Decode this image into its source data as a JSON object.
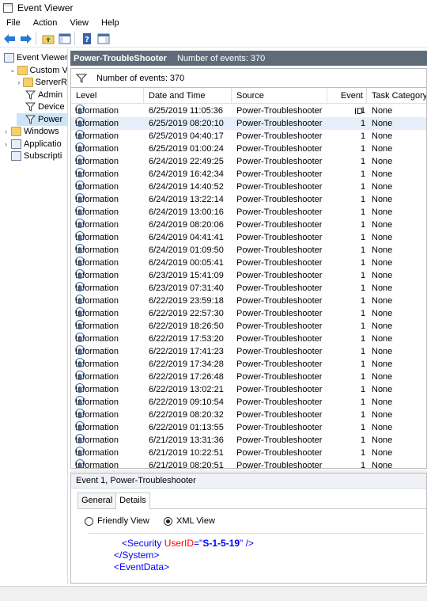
{
  "window": {
    "title": "Event Viewer"
  },
  "menu": [
    "File",
    "Action",
    "View",
    "Help"
  ],
  "toolbar": {
    "buttons": [
      "back-arrow",
      "forward-arrow",
      "folder-up",
      "show-hide-tree",
      "help-book",
      "show-hide-action-pane"
    ]
  },
  "tree": {
    "items": [
      {
        "label": "Event Viewer (",
        "indent": 0,
        "expander": "",
        "icon": "page"
      },
      {
        "label": "Custom V",
        "indent": 1,
        "expander": "⌄",
        "icon": "folder"
      },
      {
        "label": "ServerR",
        "indent": 2,
        "expander": "›",
        "icon": "folder"
      },
      {
        "label": "Admin",
        "indent": 2,
        "expander": "",
        "icon": "filter"
      },
      {
        "label": "Device",
        "indent": 2,
        "expander": "",
        "icon": "filter"
      },
      {
        "label": "Power",
        "indent": 2,
        "expander": "",
        "icon": "filter",
        "selected": true
      },
      {
        "label": "Windows",
        "indent": 0,
        "expander": "›",
        "icon": "folder"
      },
      {
        "label": "Applicatio",
        "indent": 0,
        "expander": "›",
        "icon": "page"
      },
      {
        "label": "Subscripti",
        "indent": 0,
        "expander": "",
        "icon": "page"
      }
    ]
  },
  "pane": {
    "title": "Power-TroubleShooter",
    "count_text": "Number of events: 370",
    "filter_text": "Number of events: 370"
  },
  "grid": {
    "columns": [
      "Level",
      "Date and Time",
      "Source",
      "Event ID",
      "Task Category"
    ],
    "rows": [
      [
        "Information",
        "6/25/2019 11:05:36",
        "Power-Troubleshooter",
        "1",
        "None"
      ],
      [
        "Information",
        "6/25/2019 08:20:10",
        "Power-Troubleshooter",
        "1",
        "None"
      ],
      [
        "Information",
        "6/25/2019 04:40:17",
        "Power-Troubleshooter",
        "1",
        "None"
      ],
      [
        "Information",
        "6/25/2019 01:00:24",
        "Power-Troubleshooter",
        "1",
        "None"
      ],
      [
        "Information",
        "6/24/2019 22:49:25",
        "Power-Troubleshooter",
        "1",
        "None"
      ],
      [
        "Information",
        "6/24/2019 16:42:34",
        "Power-Troubleshooter",
        "1",
        "None"
      ],
      [
        "Information",
        "6/24/2019 14:40:52",
        "Power-Troubleshooter",
        "1",
        "None"
      ],
      [
        "Information",
        "6/24/2019 13:22:14",
        "Power-Troubleshooter",
        "1",
        "None"
      ],
      [
        "Information",
        "6/24/2019 13:00:16",
        "Power-Troubleshooter",
        "1",
        "None"
      ],
      [
        "Information",
        "6/24/2019 08:20:06",
        "Power-Troubleshooter",
        "1",
        "None"
      ],
      [
        "Information",
        "6/24/2019 04:41:41",
        "Power-Troubleshooter",
        "1",
        "None"
      ],
      [
        "Information",
        "6/24/2019 01:09:50",
        "Power-Troubleshooter",
        "1",
        "None"
      ],
      [
        "Information",
        "6/24/2019 00:05:41",
        "Power-Troubleshooter",
        "1",
        "None"
      ],
      [
        "Information",
        "6/23/2019 15:41:09",
        "Power-Troubleshooter",
        "1",
        "None"
      ],
      [
        "Information",
        "6/23/2019 07:31:40",
        "Power-Troubleshooter",
        "1",
        "None"
      ],
      [
        "Information",
        "6/22/2019 23:59:18",
        "Power-Troubleshooter",
        "1",
        "None"
      ],
      [
        "Information",
        "6/22/2019 22:57:30",
        "Power-Troubleshooter",
        "1",
        "None"
      ],
      [
        "Information",
        "6/22/2019 18:26:50",
        "Power-Troubleshooter",
        "1",
        "None"
      ],
      [
        "Information",
        "6/22/2019 17:53:20",
        "Power-Troubleshooter",
        "1",
        "None"
      ],
      [
        "Information",
        "6/22/2019 17:41:23",
        "Power-Troubleshooter",
        "1",
        "None"
      ],
      [
        "Information",
        "6/22/2019 17:34:28",
        "Power-Troubleshooter",
        "1",
        "None"
      ],
      [
        "Information",
        "6/22/2019 17:26:48",
        "Power-Troubleshooter",
        "1",
        "None"
      ],
      [
        "Information",
        "6/22/2019 13:02:21",
        "Power-Troubleshooter",
        "1",
        "None"
      ],
      [
        "Information",
        "6/22/2019 09:10:54",
        "Power-Troubleshooter",
        "1",
        "None"
      ],
      [
        "Information",
        "6/22/2019 08:20:32",
        "Power-Troubleshooter",
        "1",
        "None"
      ],
      [
        "Information",
        "6/22/2019 01:13:55",
        "Power-Troubleshooter",
        "1",
        "None"
      ],
      [
        "Information",
        "6/21/2019 13:31:36",
        "Power-Troubleshooter",
        "1",
        "None"
      ],
      [
        "Information",
        "6/21/2019 10:22:51",
        "Power-Troubleshooter",
        "1",
        "None"
      ],
      [
        "Information",
        "6/21/2019 08:20:51",
        "Power-Troubleshooter",
        "1",
        "None"
      ]
    ],
    "selected_row": 1
  },
  "details": {
    "title": "Event 1, Power-Troubleshooter",
    "tabs": [
      "General",
      "Details"
    ],
    "active_tab": "Details",
    "view_options": [
      "Friendly View",
      "XML View"
    ],
    "selected_view": "XML View",
    "xml": {
      "line1_tag": "<Security",
      "line1_attr": " UserID",
      "line1_eq": "=\"",
      "line1_val": "S-1-5-19",
      "line1_end": "\" />",
      "line2": "</System>",
      "line3": "<EventData>"
    }
  },
  "colors": {
    "header_bg": "#5f6b79",
    "selection": "#cce4f7",
    "row_selection": "#e5eef9"
  }
}
